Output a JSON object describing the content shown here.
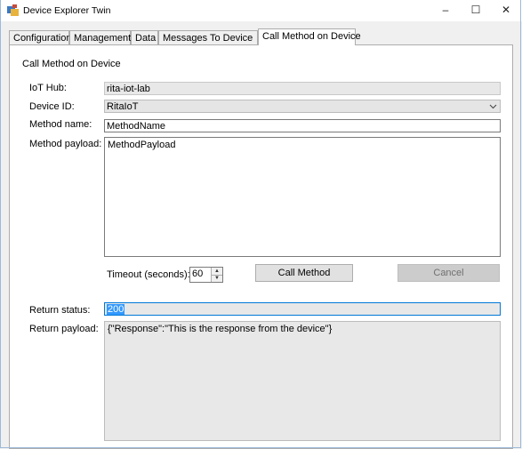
{
  "window": {
    "title": "Device Explorer Twin",
    "controls": {
      "minimize": "–",
      "maximize": "☐",
      "close": "✕"
    }
  },
  "tabs": [
    "Configuration",
    "Management",
    "Data",
    "Messages To Device",
    "Call Method on Device"
  ],
  "active_tab": "Call Method on Device",
  "form": {
    "section_title": "Call Method on Device",
    "iot_hub_label": "IoT Hub:",
    "iot_hub_value": "rita-iot-lab",
    "device_id_label": "Device ID:",
    "device_id_value": "RitaIoT",
    "method_name_label": "Method name:",
    "method_name_value": "MethodName",
    "method_payload_label": "Method payload:",
    "method_payload_value": "MethodPayload",
    "timeout_label": "Timeout (seconds):",
    "timeout_value": "60",
    "call_button": "Call Method",
    "cancel_button": "Cancel",
    "return_status_label": "Return status:",
    "return_status_value": "200",
    "return_payload_label": "Return payload:",
    "return_payload_value": "{\"Response\":\"This is the response from the device\"}"
  },
  "colors": {
    "selection": "#3399ff",
    "focus_border": "#0078d7",
    "disabled_button": "#cccccc"
  }
}
